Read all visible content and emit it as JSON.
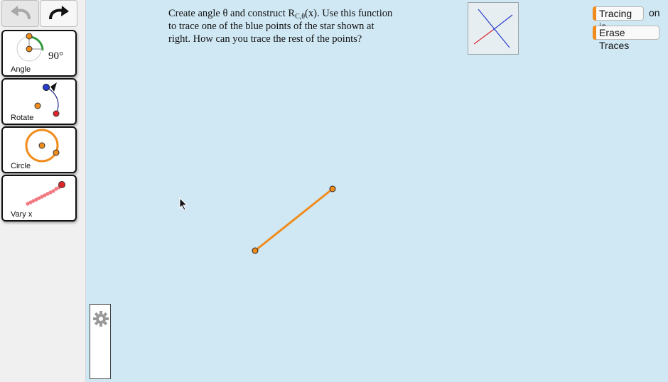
{
  "toolbar": {
    "undo_icon": "undo-arrow-icon",
    "redo_icon": "redo-arrow-icon"
  },
  "tools": [
    {
      "id": "angle",
      "label": "Angle",
      "value_label": "90°"
    },
    {
      "id": "rotate",
      "label": "Rotate"
    },
    {
      "id": "circle",
      "label": "Circle"
    },
    {
      "id": "vary",
      "label": "Vary x"
    }
  ],
  "instructions": {
    "line1_pre": "Create angle θ and construct R",
    "line1_sub": "C,θ",
    "line1_post": "(x). Use this function",
    "line2": "to trace one of the blue points of the star shown at",
    "line3": "right. How can you trace the rest of the points?"
  },
  "controls": {
    "tracing_label": "Tracing is",
    "tracing_state": "on",
    "erase_label": "Erase Traces"
  },
  "colors": {
    "canvas_bg": "#d0e8f4",
    "segment": "#f08c1c",
    "point_fill": "#f08c1c",
    "star_blue": "#2a3fcf",
    "star_red": "#e0262a"
  }
}
